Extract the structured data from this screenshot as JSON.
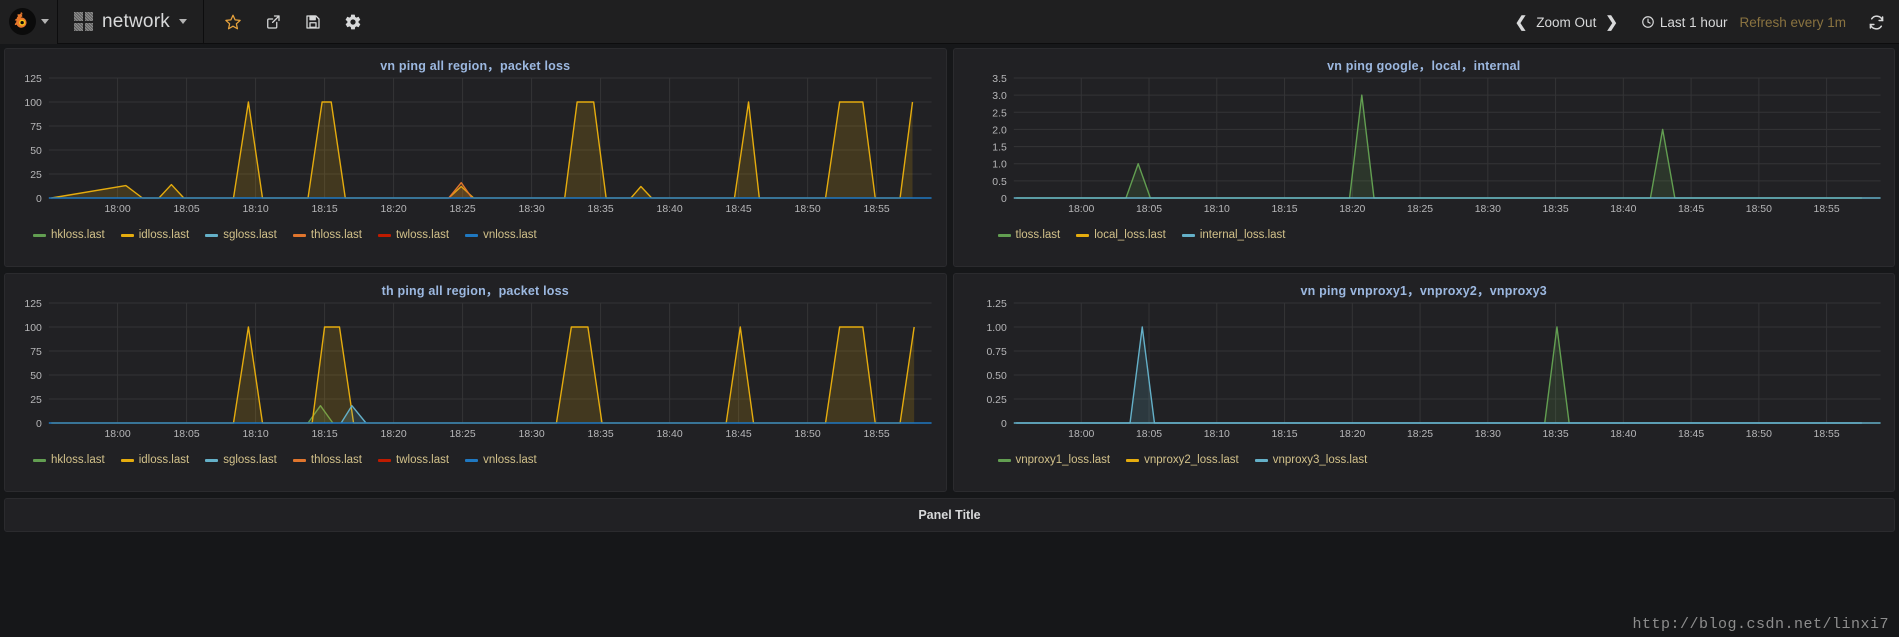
{
  "navbar": {
    "logo_icon": "grafana-logo-icon",
    "logo_caret_icon": "chevron-down-icon",
    "dashboard_grid_icon": "dashboard-grid-icon",
    "dashboard_title": "network",
    "dashboard_caret_icon": "chevron-down-icon",
    "icons": [
      {
        "name": "star-icon",
        "label": "Mark as favorite"
      },
      {
        "name": "share-icon",
        "label": "Share dashboard"
      },
      {
        "name": "save-icon",
        "label": "Save dashboard"
      },
      {
        "name": "settings-gear-icon",
        "label": "Dashboard settings"
      }
    ],
    "time_prev_icon": "chevron-left-icon",
    "zoom_out_label": "Zoom Out",
    "time_next_icon": "chevron-right-icon",
    "clock_icon": "clock-icon",
    "time_range_label": "Last 1 hour",
    "refresh_interval_label": "Refresh every 1m",
    "refresh_icon": "refresh-icon"
  },
  "panels": [
    {
      "title": "vn ping all region，packet loss",
      "legend": [
        {
          "label": "hkloss.last",
          "color": "#629e51"
        },
        {
          "label": "idloss.last",
          "color": "#e5ac0e"
        },
        {
          "label": "sgloss.last",
          "color": "#64b0c8"
        },
        {
          "label": "thloss.last",
          "color": "#e0752d"
        },
        {
          "label": "twloss.last",
          "color": "#bf1b00"
        },
        {
          "label": "vnloss.last",
          "color": "#1f78c1"
        }
      ]
    },
    {
      "title": "vn ping google，local，internal",
      "legend": [
        {
          "label": "tloss.last",
          "color": "#629e51"
        },
        {
          "label": "local_loss.last",
          "color": "#e5ac0e"
        },
        {
          "label": "internal_loss.last",
          "color": "#64b0c8"
        }
      ]
    },
    {
      "title": "th ping all region，packet loss",
      "legend": [
        {
          "label": "hkloss.last",
          "color": "#629e51"
        },
        {
          "label": "idloss.last",
          "color": "#e5ac0e"
        },
        {
          "label": "sgloss.last",
          "color": "#64b0c8"
        },
        {
          "label": "thloss.last",
          "color": "#e0752d"
        },
        {
          "label": "twloss.last",
          "color": "#bf1b00"
        },
        {
          "label": "vnloss.last",
          "color": "#1f78c1"
        }
      ]
    },
    {
      "title": "vn ping vnproxy1，vnproxy2，vnproxy3",
      "legend": [
        {
          "label": "vnproxy1_loss.last",
          "color": "#629e51"
        },
        {
          "label": "vnproxy2_loss.last",
          "color": "#e5ac0e"
        },
        {
          "label": "vnproxy3_loss.last",
          "color": "#64b0c8"
        }
      ]
    }
  ],
  "bottom_panel": {
    "title": "Panel Title"
  },
  "watermark": "http://blog.csdn.net/linxi7",
  "chart_data": [
    {
      "type": "line",
      "title": "vn ping all region，packet loss",
      "xlabel": "",
      "ylabel": "",
      "ylim": [
        0,
        125
      ],
      "yticks": [
        0,
        25,
        50,
        75,
        100,
        125
      ],
      "xticks": [
        "18:00",
        "18:05",
        "18:10",
        "18:15",
        "18:20",
        "18:25",
        "18:30",
        "18:35",
        "18:40",
        "18:45",
        "18:50",
        "18:55"
      ],
      "grid": true,
      "legend_position": "bottom",
      "series": [
        {
          "name": "hkloss.last",
          "color": "#629e51",
          "points": []
        },
        {
          "name": "idloss.last",
          "color": "#e5ac0e",
          "points": [
            [
              17.92,
              0
            ],
            [
              18.01,
              13
            ],
            [
              18.03,
              0
            ],
            [
              18.05,
              0
            ],
            [
              18.065,
              14
            ],
            [
              18.08,
              0
            ],
            [
              18.14,
              0
            ],
            [
              18.158,
              100
            ],
            [
              18.175,
              0
            ],
            [
              18.23,
              0
            ],
            [
              18.247,
              100
            ],
            [
              18.258,
              100
            ],
            [
              18.275,
              0
            ],
            [
              18.4,
              0
            ],
            [
              18.415,
              12
            ],
            [
              18.43,
              0
            ],
            [
              18.54,
              0
            ],
            [
              18.555,
              100
            ],
            [
              18.575,
              100
            ],
            [
              18.59,
              0
            ],
            [
              18.62,
              0
            ],
            [
              18.632,
              12
            ],
            [
              18.645,
              0
            ],
            [
              18.745,
              0
            ],
            [
              18.762,
              100
            ],
            [
              18.775,
              0
            ],
            [
              18.855,
              0
            ],
            [
              18.872,
              100
            ],
            [
              18.9,
              100
            ],
            [
              18.915,
              0
            ],
            [
              18.945,
              0
            ],
            [
              18.96,
              100
            ]
          ]
        },
        {
          "name": "sgloss.last",
          "color": "#64b0c8",
          "points": []
        },
        {
          "name": "thloss.last",
          "color": "#e0752d",
          "points": [
            [
              18.4,
              0
            ],
            [
              18.415,
              16
            ],
            [
              18.428,
              0
            ]
          ]
        },
        {
          "name": "twloss.last",
          "color": "#bf1b00",
          "points": []
        },
        {
          "name": "vnloss.last",
          "color": "#1f78c1",
          "points": []
        }
      ]
    },
    {
      "type": "line",
      "title": "vn ping google，local，internal",
      "xlabel": "",
      "ylabel": "",
      "ylim": [
        0,
        3.5
      ],
      "yticks": [
        0,
        0.5,
        1.0,
        1.5,
        2.0,
        2.5,
        3.0,
        3.5
      ],
      "xticks": [
        "18:00",
        "18:05",
        "18:10",
        "18:15",
        "18:20",
        "18:25",
        "18:30",
        "18:35",
        "18:40",
        "18:45",
        "18:50",
        "18:55"
      ],
      "grid": true,
      "legend_position": "bottom",
      "series": [
        {
          "name": "tloss.last",
          "color": "#629e51",
          "points": [
            [
              17.92,
              0
            ],
            [
              18.055,
              0
            ],
            [
              18.07,
              1.0
            ],
            [
              18.085,
              0
            ],
            [
              18.33,
              0
            ],
            [
              18.345,
              3.0
            ],
            [
              18.36,
              0
            ],
            [
              18.7,
              0
            ],
            [
              18.715,
              2.0
            ],
            [
              18.73,
              0
            ],
            [
              18.96,
              0
            ]
          ]
        },
        {
          "name": "local_loss.last",
          "color": "#e5ac0e",
          "points": []
        },
        {
          "name": "internal_loss.last",
          "color": "#64b0c8",
          "points": []
        }
      ]
    },
    {
      "type": "line",
      "title": "th ping all region，packet loss",
      "xlabel": "",
      "ylabel": "",
      "ylim": [
        0,
        125
      ],
      "yticks": [
        0,
        25,
        50,
        75,
        100,
        125
      ],
      "xticks": [
        "18:00",
        "18:05",
        "18:10",
        "18:15",
        "18:20",
        "18:25",
        "18:30",
        "18:35",
        "18:40",
        "18:45",
        "18:50",
        "18:55"
      ],
      "grid": true,
      "legend_position": "bottom",
      "series": [
        {
          "name": "hkloss.last",
          "color": "#629e51",
          "points": [
            [
              18.23,
              0
            ],
            [
              18.245,
              18
            ],
            [
              18.26,
              0
            ]
          ]
        },
        {
          "name": "idloss.last",
          "color": "#e5ac0e",
          "points": [
            [
              17.92,
              0
            ],
            [
              18.14,
              0
            ],
            [
              18.158,
              100
            ],
            [
              18.175,
              0
            ],
            [
              18.235,
              0
            ],
            [
              18.25,
              100
            ],
            [
              18.268,
              100
            ],
            [
              18.285,
              0
            ],
            [
              18.53,
              0
            ],
            [
              18.548,
              100
            ],
            [
              18.568,
              100
            ],
            [
              18.585,
              0
            ],
            [
              18.735,
              0
            ],
            [
              18.752,
              100
            ],
            [
              18.768,
              0
            ],
            [
              18.855,
              0
            ],
            [
              18.872,
              100
            ],
            [
              18.9,
              100
            ],
            [
              18.915,
              0
            ],
            [
              18.945,
              0
            ],
            [
              18.962,
              100
            ]
          ]
        },
        {
          "name": "sgloss.last",
          "color": "#64b0c8",
          "points": [
            [
              18.27,
              0
            ],
            [
              18.283,
              18
            ],
            [
              18.3,
              0
            ]
          ]
        },
        {
          "name": "thloss.last",
          "color": "#e0752d",
          "points": []
        },
        {
          "name": "twloss.last",
          "color": "#bf1b00",
          "points": []
        },
        {
          "name": "vnloss.last",
          "color": "#1f78c1",
          "points": []
        }
      ]
    },
    {
      "type": "line",
      "title": "vn ping vnproxy1，vnproxy2，vnproxy3",
      "xlabel": "",
      "ylabel": "",
      "ylim": [
        0,
        1.25
      ],
      "yticks": [
        0,
        0.25,
        0.5,
        0.75,
        1.0,
        1.25
      ],
      "xticks": [
        "18:00",
        "18:05",
        "18:10",
        "18:15",
        "18:20",
        "18:25",
        "18:30",
        "18:35",
        "18:40",
        "18:45",
        "18:50",
        "18:55"
      ],
      "grid": true,
      "legend_position": "bottom",
      "series": [
        {
          "name": "vnproxy1_loss.last",
          "color": "#629e51",
          "points": [
            [
              18.57,
              0
            ],
            [
              18.585,
              1.0
            ],
            [
              18.6,
              0
            ]
          ]
        },
        {
          "name": "vnproxy2_loss.last",
          "color": "#e5ac0e",
          "points": []
        },
        {
          "name": "vnproxy3_loss.last",
          "color": "#64b0c8",
          "points": [
            [
              17.92,
              0
            ],
            [
              18.06,
              0
            ],
            [
              18.075,
              1.0
            ],
            [
              18.09,
              0
            ],
            [
              18.96,
              0
            ]
          ]
        }
      ]
    }
  ]
}
